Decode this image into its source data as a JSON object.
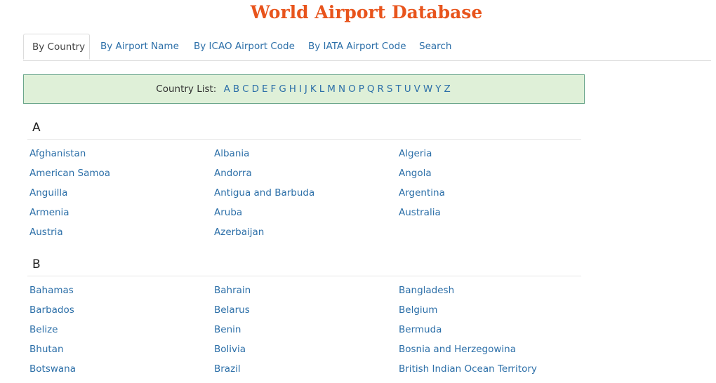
{
  "header": {
    "title": "World Airport Database"
  },
  "tabs": [
    {
      "label": "By Country",
      "active": true
    },
    {
      "label": "By Airport Name",
      "active": false
    },
    {
      "label": "By ICAO Airport Code",
      "active": false
    },
    {
      "label": "By IATA Airport Code",
      "active": false
    },
    {
      "label": "Search",
      "active": false
    }
  ],
  "country_list": {
    "label": "Country List:",
    "letters": [
      "A",
      "B",
      "C",
      "D",
      "E",
      "F",
      "G",
      "H",
      "I",
      "J",
      "K",
      "L",
      "M",
      "N",
      "O",
      "P",
      "Q",
      "R",
      "S",
      "T",
      "U",
      "V",
      "W",
      "Y",
      "Z"
    ]
  },
  "sections": [
    {
      "letter": "A",
      "countries": [
        "Afghanistan",
        "Albania",
        "Algeria",
        "American Samoa",
        "Andorra",
        "Angola",
        "Anguilla",
        "Antigua and Barbuda",
        "Argentina",
        "Armenia",
        "Aruba",
        "Australia",
        "Austria",
        "Azerbaijan"
      ]
    },
    {
      "letter": "B",
      "countries": [
        "Bahamas",
        "Bahrain",
        "Bangladesh",
        "Barbados",
        "Belarus",
        "Belgium",
        "Belize",
        "Benin",
        "Bermuda",
        "Bhutan",
        "Bolivia",
        "Bosnia and Herzegowina",
        "Botswana",
        "Brazil",
        "British Indian Ocean Territory"
      ]
    }
  ],
  "colors": {
    "title": "#e8541c",
    "link": "#2c6fa8",
    "list_box_bg": "#dff0d8",
    "list_box_border": "#6aa68a"
  }
}
